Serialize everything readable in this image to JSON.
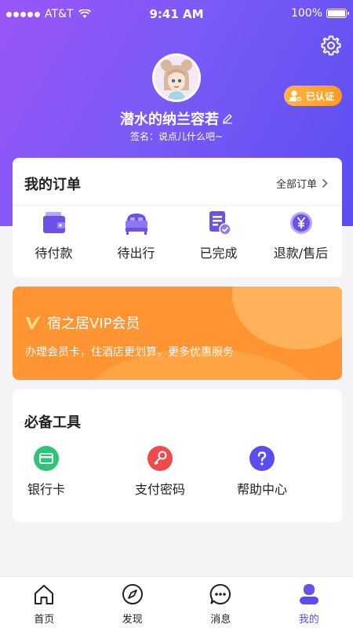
{
  "status_bar": {
    "carrier": "AT&T",
    "time": "9:41 AM",
    "battery": "100%"
  },
  "profile": {
    "name": "潜水的纳兰容若",
    "signature": "签名：说点儿什么吧~",
    "verified_label": "已认证"
  },
  "orders": {
    "title": "我的订单",
    "all_label": "全部订单",
    "items": [
      {
        "label": "待付款",
        "icon": "wallet-icon"
      },
      {
        "label": "待出行",
        "icon": "bed-icon"
      },
      {
        "label": "已完成",
        "icon": "completed-doc-icon"
      },
      {
        "label": "退款/售后",
        "icon": "refund-yen-icon"
      }
    ]
  },
  "vip": {
    "title": "宿之居VIP会员",
    "description": "办理会员卡，住酒店更划算，更多优惠服务"
  },
  "tools": {
    "title": "必备工具",
    "items": [
      {
        "label": "银行卡",
        "icon": "bank-card-icon"
      },
      {
        "label": "支付密码",
        "icon": "key-icon"
      },
      {
        "label": "帮助中心",
        "icon": "help-icon"
      }
    ]
  },
  "tabbar": {
    "items": [
      {
        "label": "首页",
        "icon": "home-icon"
      },
      {
        "label": "发现",
        "icon": "compass-icon"
      },
      {
        "label": "消息",
        "icon": "message-icon"
      },
      {
        "label": "我的",
        "icon": "user-icon"
      }
    ],
    "active_index": 3
  },
  "colors": {
    "header_gradient_start": "#9b55f7",
    "header_gradient_end": "#5a4ef0",
    "vip_orange": "#ff9532",
    "active_tab": "#5b4ef0",
    "verified_badge": "#ffa030"
  }
}
